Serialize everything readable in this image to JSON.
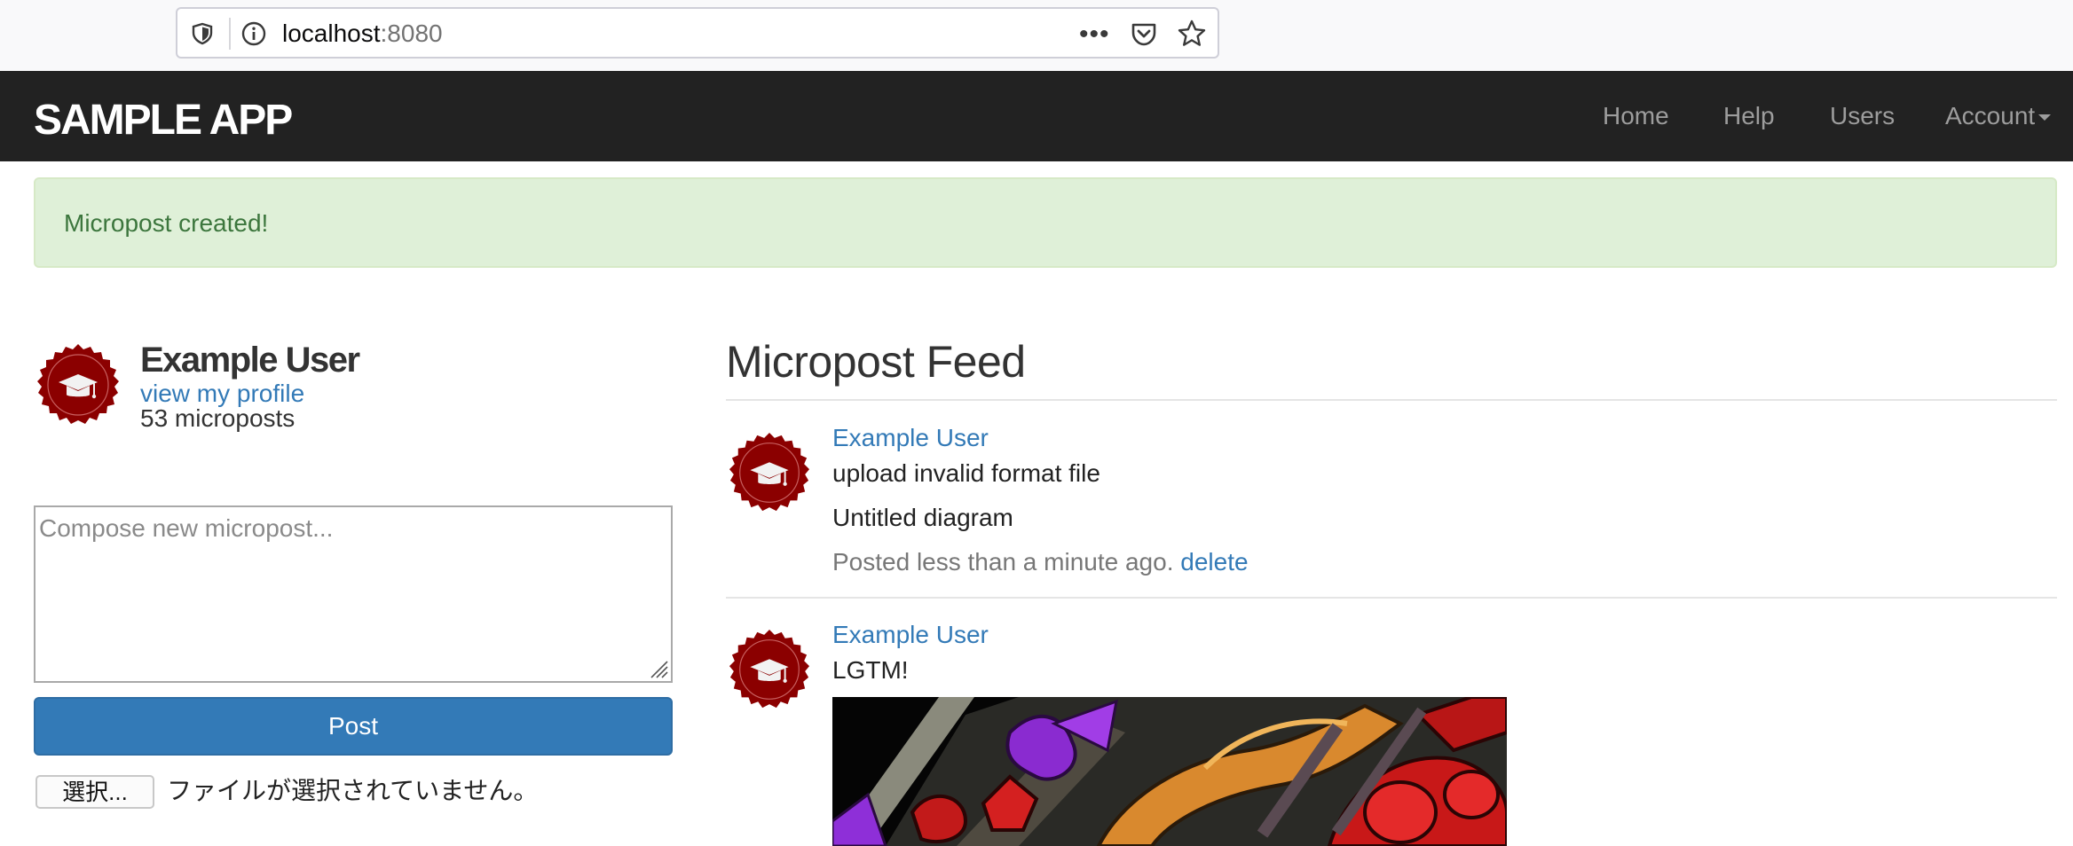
{
  "browser": {
    "url_host": "localhost",
    "url_port": ":8080"
  },
  "navbar": {
    "logo": "SAMPLE APP",
    "links": [
      {
        "label": "Home"
      },
      {
        "label": "Help"
      },
      {
        "label": "Users"
      },
      {
        "label": "Account"
      }
    ]
  },
  "alert": {
    "message": "Micropost created!"
  },
  "sidebar": {
    "user_name": "Example User",
    "profile_link": "view my profile",
    "post_count": "53 microposts",
    "compose_placeholder": "Compose new micropost...",
    "post_button": "Post",
    "file_button": "選択...",
    "file_status": "ファイルが選択されていません。"
  },
  "feed": {
    "title": "Micropost Feed",
    "items": [
      {
        "user": "Example User",
        "content": "upload invalid format file",
        "attachment_name": "Untitled diagram",
        "timestamp": "Posted less than a minute ago.",
        "delete_label": "delete"
      },
      {
        "user": "Example User",
        "content": "LGTM!"
      }
    ]
  },
  "colors": {
    "navbar_bg": "#222222",
    "link": "#337ab7",
    "alert_bg": "#dff0d8",
    "alert_text": "#3c763d",
    "primary_button": "#337ab7",
    "avatar": "#8b0000"
  }
}
